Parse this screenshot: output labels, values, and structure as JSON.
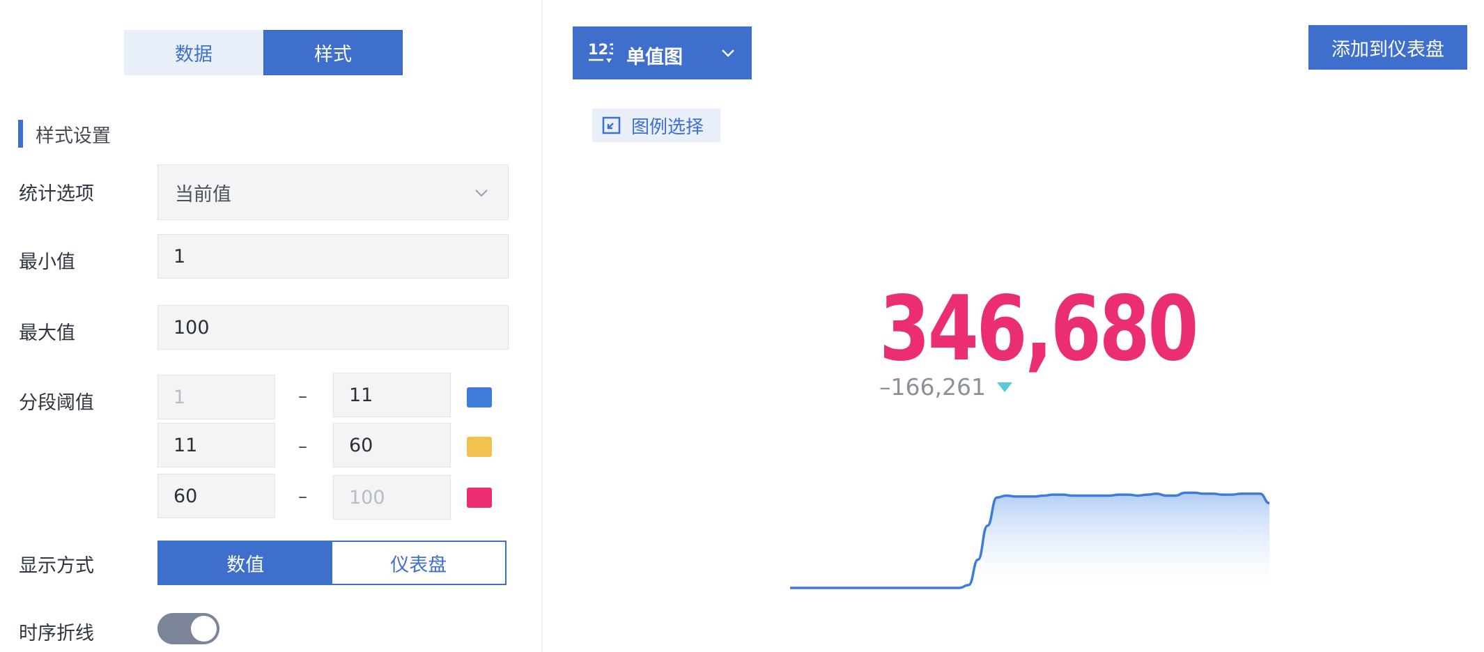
{
  "tabs": {
    "data_label": "数据",
    "style_label": "样式"
  },
  "section": {
    "title": "样式设置"
  },
  "stat_option": {
    "label": "统计选项",
    "value": "当前值"
  },
  "min": {
    "label": "最小值",
    "value": "1"
  },
  "max": {
    "label": "最大值",
    "value": "100"
  },
  "threshold": {
    "label": "分段阈值",
    "separator": "–",
    "rows": [
      {
        "from": "1",
        "to": "11",
        "from_placeholder": true,
        "to_placeholder": false,
        "color": "#3f7bd9"
      },
      {
        "from": "11",
        "to": "60",
        "from_placeholder": false,
        "to_placeholder": false,
        "color": "#f2c14e"
      },
      {
        "from": "60",
        "to": "100",
        "from_placeholder": false,
        "to_placeholder": true,
        "color": "#ea2e71"
      }
    ]
  },
  "display_mode": {
    "label": "显示方式",
    "options": [
      "数值",
      "仪表盘"
    ],
    "selected": "数值"
  },
  "timeseries": {
    "label": "时序折线",
    "enabled": true
  },
  "chart_type": {
    "icon_label": "123",
    "label": "单值图"
  },
  "add_button": {
    "label": "添加到仪表盘"
  },
  "legend_button": {
    "label": "图例选择"
  },
  "value": {
    "main": "346,680",
    "delta": "–166,261",
    "trend": "down",
    "color": "#ea2e71"
  },
  "chart_data": {
    "type": "area",
    "values": [
      0,
      0,
      0,
      0,
      0,
      0,
      0,
      0,
      0,
      0,
      0,
      0,
      0,
      0,
      0,
      0,
      0,
      0,
      0,
      3,
      30,
      66,
      96,
      98,
      97,
      97,
      97,
      98,
      99,
      99,
      98,
      98,
      98,
      98,
      98,
      99,
      99,
      98,
      99,
      100,
      98,
      98,
      101,
      101,
      100,
      100,
      99,
      99,
      100,
      100,
      100,
      90
    ],
    "ylim": [
      0,
      105
    ]
  }
}
